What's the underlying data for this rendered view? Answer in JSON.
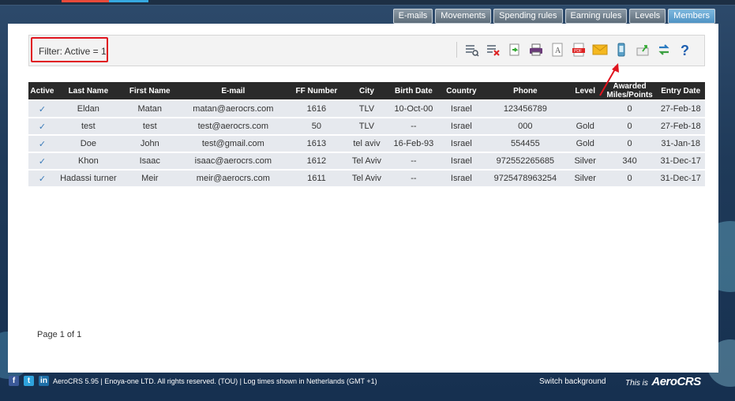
{
  "nav": {
    "tabs": [
      {
        "label": "E-mails"
      },
      {
        "label": "Movements"
      },
      {
        "label": "Spending rules"
      },
      {
        "label": "Earning rules"
      },
      {
        "label": "Levels"
      },
      {
        "label": "Members"
      }
    ],
    "active": "Members"
  },
  "toolbar": {
    "filter_text": "Filter: Active = 1",
    "icons": [
      "view-icon",
      "delete-icon",
      "export-icon",
      "print-icon",
      "text-icon",
      "pdf-icon",
      "email-icon",
      "sms-icon",
      "import-icon",
      "sync-icon",
      "help-icon"
    ]
  },
  "table": {
    "headers": [
      "Active",
      "Last Name",
      "First Name",
      "E-mail",
      "FF Number",
      "City",
      "Birth Date",
      "Country",
      "Phone",
      "Level",
      "Awarded Miles/Points",
      "Entry Date"
    ],
    "rows": [
      [
        "✓",
        "Eldan",
        "Matan",
        "matan@aerocrs.com",
        "1616",
        "TLV",
        "10-Oct-00",
        "Israel",
        "123456789",
        "",
        "0",
        "27-Feb-18"
      ],
      [
        "✓",
        "test",
        "test",
        "test@aerocrs.com",
        "50",
        "TLV",
        "--",
        "Israel",
        "000",
        "Gold",
        "0",
        "27-Feb-18"
      ],
      [
        "✓",
        "Doe",
        "John",
        "test@gmail.com",
        "1613",
        "tel aviv",
        "16-Feb-93",
        "Israel",
        "554455",
        "Gold",
        "0",
        "31-Jan-18"
      ],
      [
        "✓",
        "Khon",
        "Isaac",
        "isaac@aerocrs.com",
        "1612",
        "Tel Aviv",
        "--",
        "Israel",
        "972552265685",
        "Silver",
        "340",
        "31-Dec-17"
      ],
      [
        "✓",
        "Hadassi turner",
        "Meir",
        "meir@aerocrs.com",
        "1611",
        "Tel Aviv",
        "--",
        "Israel",
        "9725478963254",
        "Silver",
        "0",
        "31-Dec-17"
      ]
    ]
  },
  "pager": {
    "text": "Page 1 of 1"
  },
  "footer": {
    "text": "AeroCRS 5.95  | Enoya-one LTD. All rights reserved. (TOU)  | Log times shown in Netherlands (GMT +1)",
    "switch_background": "Switch background",
    "brand_prefix": "This is",
    "brand_name": "AeroCRS"
  },
  "colors": {
    "accent": "#4f93c4",
    "highlight": "#e0141e",
    "header_bg": "#2a2a2a",
    "row_bg": "#e6e9ee"
  }
}
